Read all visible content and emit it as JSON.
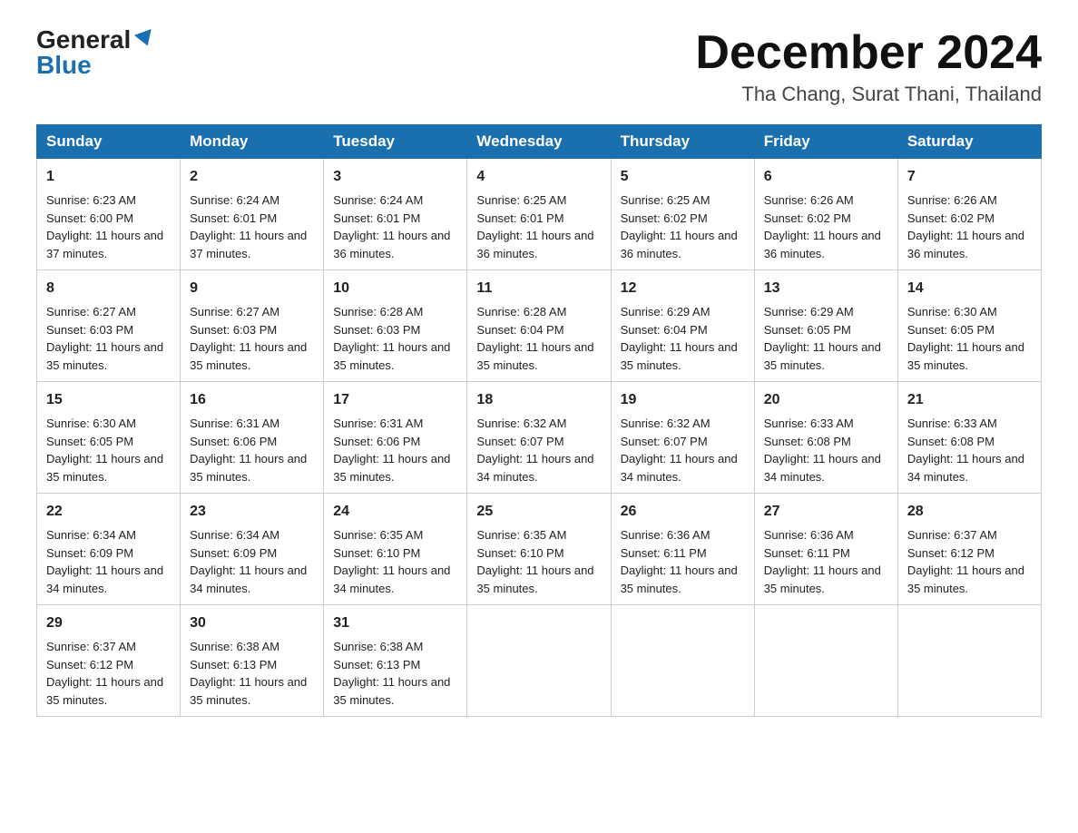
{
  "header": {
    "logo_general": "General",
    "logo_blue": "Blue",
    "month_title": "December 2024",
    "location": "Tha Chang, Surat Thani, Thailand"
  },
  "weekdays": [
    "Sunday",
    "Monday",
    "Tuesday",
    "Wednesday",
    "Thursday",
    "Friday",
    "Saturday"
  ],
  "weeks": [
    [
      {
        "day": "1",
        "sunrise": "6:23 AM",
        "sunset": "6:00 PM",
        "daylight": "11 hours and 37 minutes."
      },
      {
        "day": "2",
        "sunrise": "6:24 AM",
        "sunset": "6:01 PM",
        "daylight": "11 hours and 37 minutes."
      },
      {
        "day": "3",
        "sunrise": "6:24 AM",
        "sunset": "6:01 PM",
        "daylight": "11 hours and 36 minutes."
      },
      {
        "day": "4",
        "sunrise": "6:25 AM",
        "sunset": "6:01 PM",
        "daylight": "11 hours and 36 minutes."
      },
      {
        "day": "5",
        "sunrise": "6:25 AM",
        "sunset": "6:02 PM",
        "daylight": "11 hours and 36 minutes."
      },
      {
        "day": "6",
        "sunrise": "6:26 AM",
        "sunset": "6:02 PM",
        "daylight": "11 hours and 36 minutes."
      },
      {
        "day": "7",
        "sunrise": "6:26 AM",
        "sunset": "6:02 PM",
        "daylight": "11 hours and 36 minutes."
      }
    ],
    [
      {
        "day": "8",
        "sunrise": "6:27 AM",
        "sunset": "6:03 PM",
        "daylight": "11 hours and 35 minutes."
      },
      {
        "day": "9",
        "sunrise": "6:27 AM",
        "sunset": "6:03 PM",
        "daylight": "11 hours and 35 minutes."
      },
      {
        "day": "10",
        "sunrise": "6:28 AM",
        "sunset": "6:03 PM",
        "daylight": "11 hours and 35 minutes."
      },
      {
        "day": "11",
        "sunrise": "6:28 AM",
        "sunset": "6:04 PM",
        "daylight": "11 hours and 35 minutes."
      },
      {
        "day": "12",
        "sunrise": "6:29 AM",
        "sunset": "6:04 PM",
        "daylight": "11 hours and 35 minutes."
      },
      {
        "day": "13",
        "sunrise": "6:29 AM",
        "sunset": "6:05 PM",
        "daylight": "11 hours and 35 minutes."
      },
      {
        "day": "14",
        "sunrise": "6:30 AM",
        "sunset": "6:05 PM",
        "daylight": "11 hours and 35 minutes."
      }
    ],
    [
      {
        "day": "15",
        "sunrise": "6:30 AM",
        "sunset": "6:05 PM",
        "daylight": "11 hours and 35 minutes."
      },
      {
        "day": "16",
        "sunrise": "6:31 AM",
        "sunset": "6:06 PM",
        "daylight": "11 hours and 35 minutes."
      },
      {
        "day": "17",
        "sunrise": "6:31 AM",
        "sunset": "6:06 PM",
        "daylight": "11 hours and 35 minutes."
      },
      {
        "day": "18",
        "sunrise": "6:32 AM",
        "sunset": "6:07 PM",
        "daylight": "11 hours and 34 minutes."
      },
      {
        "day": "19",
        "sunrise": "6:32 AM",
        "sunset": "6:07 PM",
        "daylight": "11 hours and 34 minutes."
      },
      {
        "day": "20",
        "sunrise": "6:33 AM",
        "sunset": "6:08 PM",
        "daylight": "11 hours and 34 minutes."
      },
      {
        "day": "21",
        "sunrise": "6:33 AM",
        "sunset": "6:08 PM",
        "daylight": "11 hours and 34 minutes."
      }
    ],
    [
      {
        "day": "22",
        "sunrise": "6:34 AM",
        "sunset": "6:09 PM",
        "daylight": "11 hours and 34 minutes."
      },
      {
        "day": "23",
        "sunrise": "6:34 AM",
        "sunset": "6:09 PM",
        "daylight": "11 hours and 34 minutes."
      },
      {
        "day": "24",
        "sunrise": "6:35 AM",
        "sunset": "6:10 PM",
        "daylight": "11 hours and 34 minutes."
      },
      {
        "day": "25",
        "sunrise": "6:35 AM",
        "sunset": "6:10 PM",
        "daylight": "11 hours and 35 minutes."
      },
      {
        "day": "26",
        "sunrise": "6:36 AM",
        "sunset": "6:11 PM",
        "daylight": "11 hours and 35 minutes."
      },
      {
        "day": "27",
        "sunrise": "6:36 AM",
        "sunset": "6:11 PM",
        "daylight": "11 hours and 35 minutes."
      },
      {
        "day": "28",
        "sunrise": "6:37 AM",
        "sunset": "6:12 PM",
        "daylight": "11 hours and 35 minutes."
      }
    ],
    [
      {
        "day": "29",
        "sunrise": "6:37 AM",
        "sunset": "6:12 PM",
        "daylight": "11 hours and 35 minutes."
      },
      {
        "day": "30",
        "sunrise": "6:38 AM",
        "sunset": "6:13 PM",
        "daylight": "11 hours and 35 minutes."
      },
      {
        "day": "31",
        "sunrise": "6:38 AM",
        "sunset": "6:13 PM",
        "daylight": "11 hours and 35 minutes."
      },
      null,
      null,
      null,
      null
    ]
  ]
}
